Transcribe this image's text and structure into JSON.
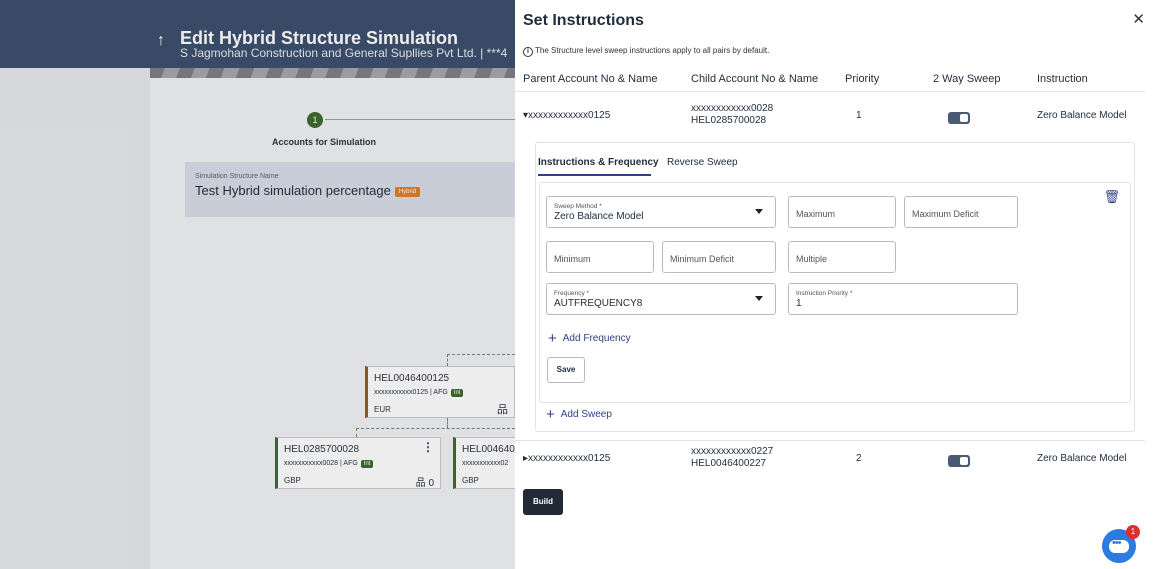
{
  "background": {
    "title": "Edit Hybrid Structure Simulation",
    "subtitle": "S Jagmohan Construction and General Supllies Pvt Ltd. | ***4",
    "back_icon": "back-arrow-icon",
    "step": {
      "number": "1",
      "label": "Accounts for Simulation"
    },
    "simulation": {
      "label": "Simulation Structure Name",
      "name": "Test Hybrid simulation percentage",
      "tag": "Hybrid"
    },
    "nodes": [
      {
        "id": "HEL0046400125",
        "detail": "xxxxxxxxxxx0125 | AFG",
        "badge": "Int",
        "currency": "EUR"
      },
      {
        "id": "HEL0285700028",
        "detail": "xxxxxxxxxxx0028 | AFG",
        "badge": "Int",
        "currency": "GBP",
        "child_count": "0"
      },
      {
        "id": "HEL004640",
        "detail": "xxxxxxxxxxx02",
        "currency": "GBP"
      }
    ]
  },
  "panel": {
    "title": "Set Instructions",
    "close_icon": "close-icon",
    "info_text": "The Structure level sweep instructions apply to all pairs by default.",
    "columns": [
      "Parent Account No & Name",
      "Child Account No & Name",
      "Priority",
      "2 Way Sweep",
      "Instruction"
    ],
    "rows": [
      {
        "parent": "xxxxxxxxxxxx0125",
        "child_acc": "xxxxxxxxxxxx0028",
        "child_name": "HEL0285700028",
        "priority": "1",
        "two_way": true,
        "instruction": "Zero Balance Model",
        "expanded": true
      },
      {
        "parent": "xxxxxxxxxxxx0125",
        "child_acc": "xxxxxxxxxxxx0227",
        "child_name": "HEL0046400227",
        "priority": "2",
        "two_way": true,
        "instruction": "Zero Balance Model",
        "expanded": false
      }
    ],
    "tabs": [
      "Instructions & Frequency",
      "Reverse Sweep"
    ],
    "form": {
      "sweep_method_label": "Sweep Method",
      "sweep_method_value": "Zero Balance Model",
      "maximum": "Maximum",
      "maximum_deficit": "Maximum Deficit",
      "minimum": "Minimum",
      "minimum_deficit": "Minimum Deficit",
      "multiple": "Multiple",
      "frequency_label": "Frequency",
      "frequency_value": "AUTFREQUENCY8",
      "priority_label": "Instruction Priority",
      "priority_value": "1",
      "required_mark": "*"
    },
    "add_frequency": "Add Frequency",
    "save": "Save",
    "add_sweep": "Add Sweep",
    "build": "Build",
    "chat_badge": "1"
  }
}
